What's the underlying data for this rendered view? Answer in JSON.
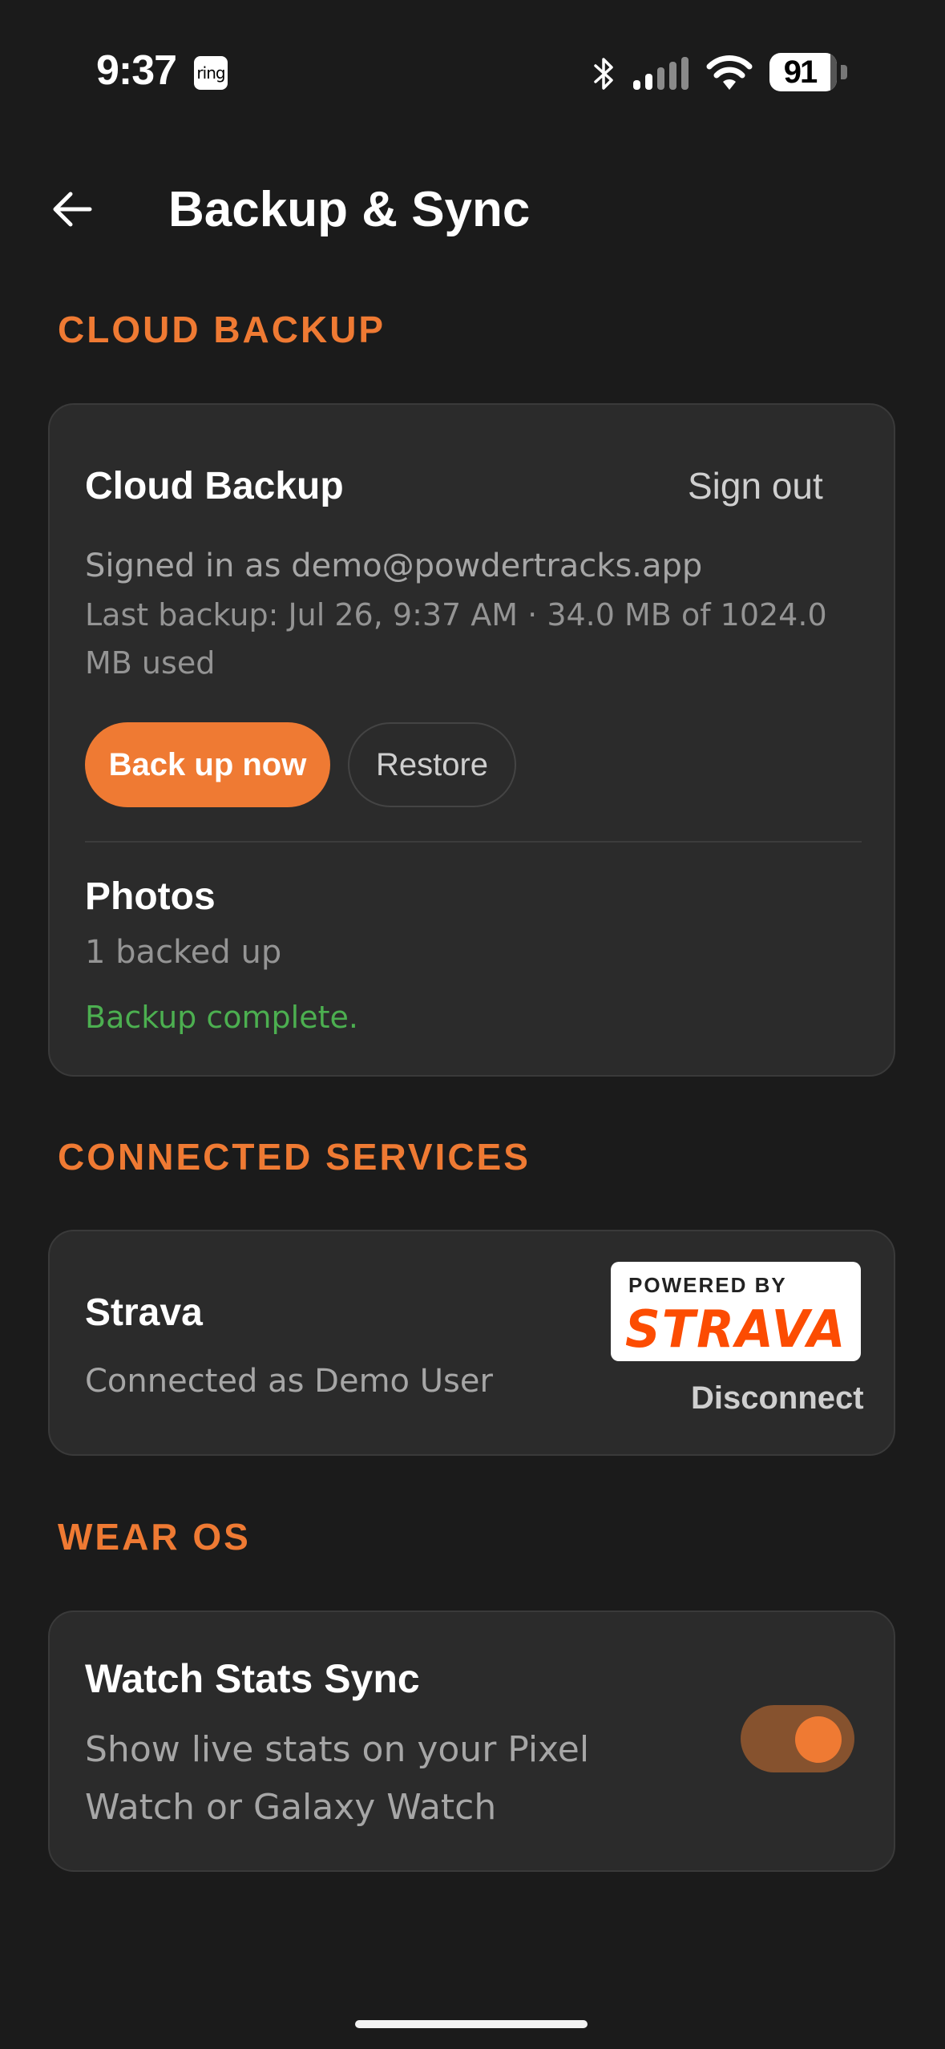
{
  "status_bar": {
    "time": "9:37",
    "ring_label": "ring",
    "battery": "91",
    "battery_level_percent": 91
  },
  "app_bar": {
    "title": "Backup & Sync",
    "back_icon": "arrow-left-icon"
  },
  "sections": {
    "cloud_backup_header": "CLOUD BACKUP",
    "connected_services_header": "CONNECTED SERVICES",
    "wear_os_header": "WEAR OS"
  },
  "cloud_backup": {
    "title": "Cloud Backup",
    "sign_out": "Sign out",
    "signed_in": "Signed in as demo@powdertracks.app",
    "last_backup_line1": "Last backup: Jul 26, 9:37 AM · 34.0 MB of 1024.0",
    "last_backup_line2": "MB used",
    "back_up_now": "Back up now",
    "restore": "Restore",
    "photos_title": "Photos",
    "photos_count": "1 backed up",
    "status": "Backup complete."
  },
  "strava": {
    "title": "Strava",
    "connected_as": "Connected as Demo User",
    "powered_by": "POWERED BY",
    "wordmark": "STRAVA",
    "disconnect": "Disconnect"
  },
  "wear_os": {
    "title": "Watch Stats Sync",
    "description_line1": "Show live stats on your Pixel",
    "description_line2": "Watch or Galaxy Watch",
    "toggle_on": true
  },
  "colors": {
    "accent": "#ef7a33",
    "background": "#1b1b1b",
    "card": "#2b2b2b",
    "success": "#4caf50",
    "strava": "#fc4c02"
  }
}
